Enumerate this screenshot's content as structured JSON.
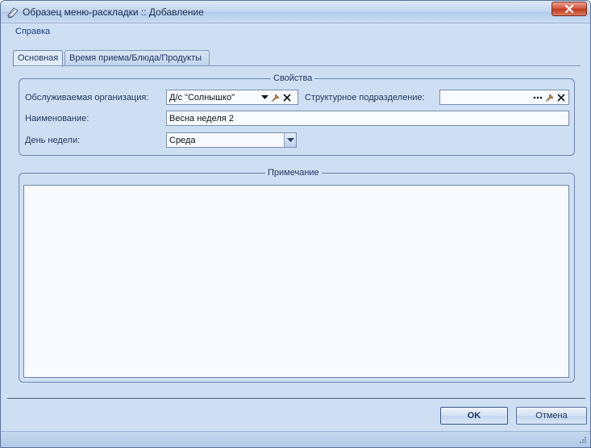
{
  "window": {
    "title": "Образец меню-раскладки :: Добавление"
  },
  "menu": {
    "help": "Справка"
  },
  "tabs": [
    {
      "label": "Основная",
      "active": true
    },
    {
      "label": "Время приема/Блюда/Продукты",
      "active": false
    }
  ],
  "properties": {
    "legend": "Свойства",
    "org_label": "Обслуживаемая организация:",
    "org_value": "Д/с \"Солнышко\"",
    "subdivision_label": "Структурное подразделение:",
    "subdivision_value": "",
    "name_label": "Наименование:",
    "name_value": "Весна неделя 2",
    "weekday_label": "День недели:",
    "weekday_value": "Среда"
  },
  "notes": {
    "legend": "Примечание",
    "value": ""
  },
  "buttons": {
    "ok": "OK",
    "cancel": "Отмена"
  },
  "icons": {
    "app": "menu-document-icon",
    "close": "close-icon",
    "dropdown": "chevron-down-icon",
    "ellipsis": "ellipsis-icon",
    "pick": "pick-icon",
    "clear": "clear-x-icon",
    "grip": "resize-grip-icon"
  },
  "colors": {
    "window_bg": "#cfdff3",
    "close_red": "#c1391f",
    "field_bg": "#f7fbff"
  }
}
